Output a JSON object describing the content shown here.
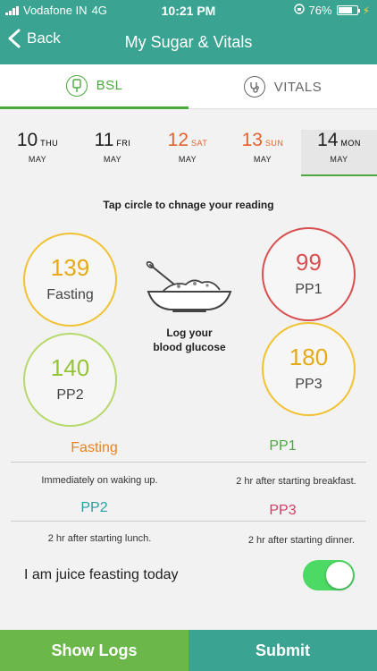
{
  "status_bar": {
    "carrier": "Vodafone IN",
    "network": "4G",
    "time": "10:21 PM",
    "battery": "76%",
    "battery_level": 0.76
  },
  "header": {
    "back_label": "Back",
    "title": "My Sugar & Vitals"
  },
  "tabs": [
    {
      "label": "BSL",
      "icon": "glucose-meter-icon",
      "active": true
    },
    {
      "label": "VITALS",
      "icon": "stethoscope-icon",
      "active": false
    }
  ],
  "dates": [
    {
      "day": "10",
      "dow": "THU",
      "month": "MAY",
      "weekend": false,
      "selected": false
    },
    {
      "day": "11",
      "dow": "FRI",
      "month": "MAY",
      "weekend": false,
      "selected": false
    },
    {
      "day": "12",
      "dow": "SAT",
      "month": "MAY",
      "weekend": true,
      "selected": false
    },
    {
      "day": "13",
      "dow": "SUN",
      "month": "MAY",
      "weekend": true,
      "selected": false
    },
    {
      "day": "14",
      "dow": "MON",
      "month": "MAY",
      "weekend": false,
      "selected": true
    }
  ],
  "hint": "Tap circle to chnage your reading",
  "readings": {
    "fasting": {
      "value": "139",
      "label": "Fasting"
    },
    "pp1": {
      "value": "99",
      "label": "PP1"
    },
    "pp2": {
      "value": "140",
      "label": "PP2"
    },
    "pp3": {
      "value": "180",
      "label": "PP3"
    }
  },
  "log_text": {
    "line1": "Log your",
    "line2": "blood glucose"
  },
  "legend": [
    {
      "title": "Fasting",
      "desc": "Immediately on waking up.",
      "color": "#e8821e"
    },
    {
      "title": "PP1",
      "desc": "2 hr after starting breakfast.",
      "color": "#4aa83f"
    },
    {
      "title": "PP2",
      "desc": "2 hr after starting lunch.",
      "color": "#2a9fa3"
    },
    {
      "title": "PP3",
      "desc": "2 hr after starting dinner.",
      "color": "#d63a66"
    }
  ],
  "juice_label": "I am juice feasting today",
  "juice_on": true,
  "buttons": {
    "show_logs": "Show Logs",
    "submit": "Submit"
  }
}
